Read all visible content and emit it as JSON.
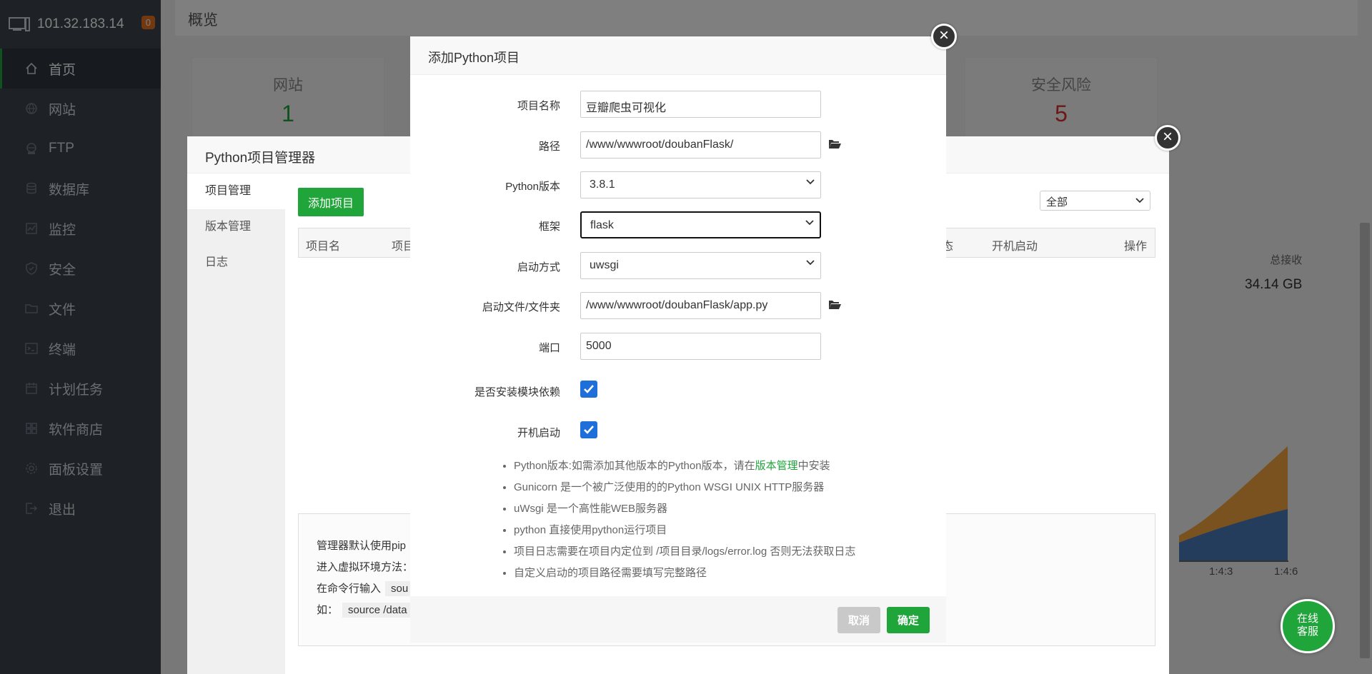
{
  "sidebar": {
    "ip": "101.32.183.14",
    "badge": "0",
    "items": [
      {
        "label": "首页",
        "icon": "home-icon"
      },
      {
        "label": "网站",
        "icon": "globe-icon"
      },
      {
        "label": "FTP",
        "icon": "ftp-icon"
      },
      {
        "label": "数据库",
        "icon": "database-icon"
      },
      {
        "label": "监控",
        "icon": "monitor-icon"
      },
      {
        "label": "安全",
        "icon": "shield-icon"
      },
      {
        "label": "文件",
        "icon": "folder-icon"
      },
      {
        "label": "终端",
        "icon": "terminal-icon"
      },
      {
        "label": "计划任务",
        "icon": "calendar-icon"
      },
      {
        "label": "软件商店",
        "icon": "apps-icon"
      },
      {
        "label": "面板设置",
        "icon": "gear-icon"
      },
      {
        "label": "退出",
        "icon": "logout-icon"
      }
    ]
  },
  "page": {
    "overview": "概览",
    "stats": [
      {
        "label": "网站",
        "value": "1",
        "color": "#20a53a"
      },
      {
        "label": "安全风险",
        "value": "5",
        "color": "#d9302f"
      }
    ],
    "total_recv_label": "总接收",
    "total_recv_value": "34.14 GB",
    "ticks": [
      "1:4:3",
      "1:4:6"
    ]
  },
  "manager": {
    "title": "Python项目管理器",
    "tabs": [
      "项目管理",
      "版本管理",
      "日志"
    ],
    "add_button": "添加项目",
    "columns": [
      "项目名",
      "项目",
      "态",
      "开机启动",
      "操作"
    ],
    "filter": "全部",
    "tips": [
      "管理器默认使用pip",
      "进入虚拟环境方法：",
      "在命令行输入",
      "如：",
      "sou",
      "source /data"
    ]
  },
  "add_dialog": {
    "title": "添加Python项目",
    "fields": {
      "name": {
        "label": "项目名称",
        "value": "豆瓣爬虫可视化"
      },
      "path": {
        "label": "路径",
        "value": "/www/wwwroot/doubanFlask/"
      },
      "pyver": {
        "label": "Python版本",
        "value": "3.8.1"
      },
      "framework": {
        "label": "框架",
        "value": "flask"
      },
      "start_mode": {
        "label": "启动方式",
        "value": "uwsgi"
      },
      "start_file": {
        "label": "启动文件/文件夹",
        "value": "/www/wwwroot/doubanFlask/app.py"
      },
      "port": {
        "label": "端口",
        "value": "5000"
      },
      "install_deps": {
        "label": "是否安装模块依赖",
        "checked": true
      },
      "autostart": {
        "label": "开机启动",
        "checked": true
      }
    },
    "help": {
      "h1_pre": "Python版本:如需添加其他版本的Python版本，请在",
      "h1_link": "版本管理",
      "h1_post": "中安装",
      "h2": "Gunicorn 是一个被广泛使用的的Python WSGI UNIX HTTP服务器",
      "h3": "uWsgi 是一个高性能WEB服务器",
      "h4": "python 直接使用python运行项目",
      "h5": "项目日志需要在项目内定位到 /项目目录/logs/error.log 否则无法获取日志",
      "h6": "自定义启动的项目路径需要填写完整路径"
    },
    "cancel": "取消",
    "ok": "确定"
  },
  "online_service": [
    "在线",
    "客服"
  ]
}
